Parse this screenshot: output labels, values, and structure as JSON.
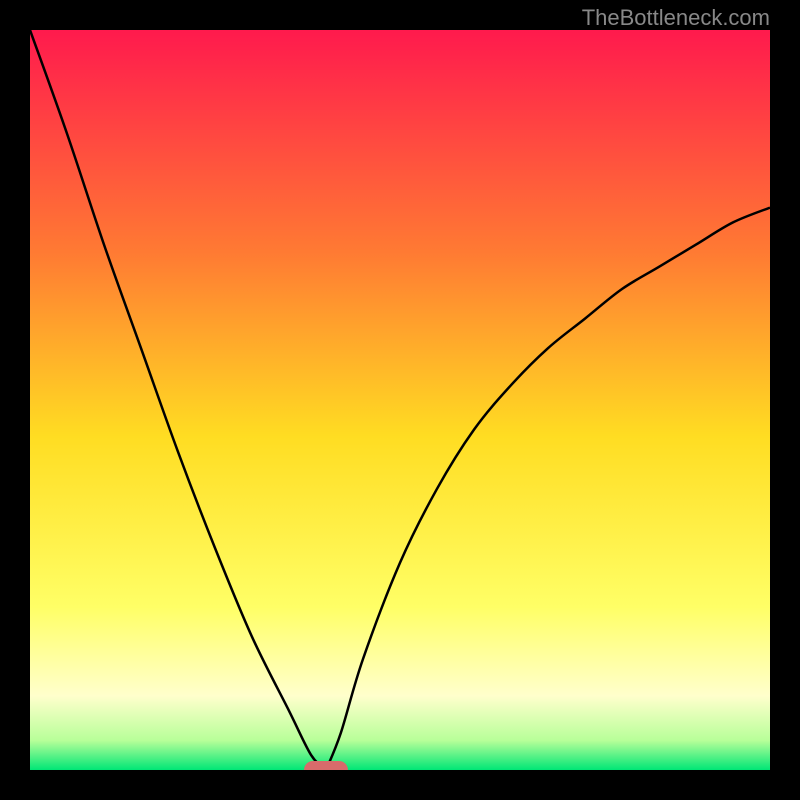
{
  "watermark": "TheBottleneck.com",
  "chart_data": {
    "type": "line",
    "title": "",
    "xlabel": "",
    "ylabel": "",
    "x_range": [
      0,
      1
    ],
    "y_range": [
      0,
      1
    ],
    "series": [
      {
        "name": "left-curve",
        "x": [
          0.0,
          0.05,
          0.1,
          0.15,
          0.2,
          0.25,
          0.3,
          0.35,
          0.38,
          0.4
        ],
        "y": [
          1.0,
          0.86,
          0.71,
          0.57,
          0.43,
          0.3,
          0.18,
          0.08,
          0.02,
          0.0
        ]
      },
      {
        "name": "right-curve",
        "x": [
          0.4,
          0.42,
          0.45,
          0.5,
          0.55,
          0.6,
          0.65,
          0.7,
          0.75,
          0.8,
          0.85,
          0.9,
          0.95,
          1.0
        ],
        "y": [
          0.0,
          0.05,
          0.15,
          0.28,
          0.38,
          0.46,
          0.52,
          0.57,
          0.61,
          0.65,
          0.68,
          0.71,
          0.74,
          0.76
        ]
      }
    ],
    "marker": {
      "x": 0.4,
      "y": 0.0,
      "color": "#d86b6b"
    },
    "background_gradient": {
      "stops": [
        {
          "offset": 0.0,
          "color": "#ff1a4d"
        },
        {
          "offset": 0.3,
          "color": "#ff7a33"
        },
        {
          "offset": 0.55,
          "color": "#ffdd22"
        },
        {
          "offset": 0.78,
          "color": "#ffff66"
        },
        {
          "offset": 0.9,
          "color": "#ffffcc"
        },
        {
          "offset": 0.96,
          "color": "#b8ff99"
        },
        {
          "offset": 1.0,
          "color": "#00e676"
        }
      ]
    }
  }
}
